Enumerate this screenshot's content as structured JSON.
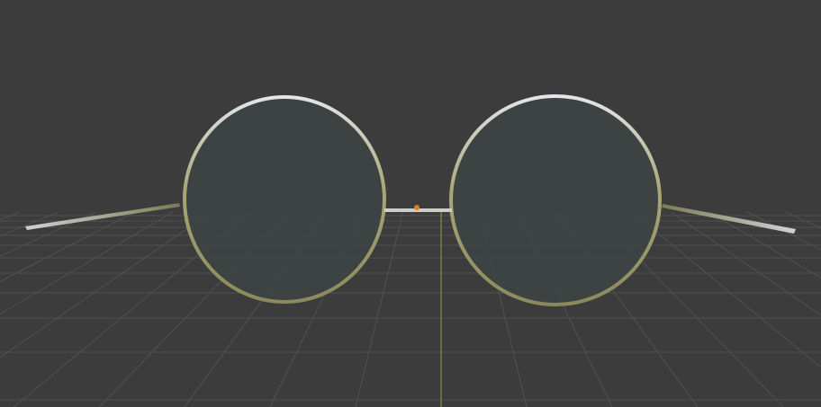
{
  "viewport": {
    "background_color": "#3c3c3c",
    "grid_color": "#565656",
    "axis_y_color": "#6e9a3a",
    "grid_visible": true
  },
  "model": {
    "name": "",
    "frame_color": "#9a9a6a",
    "frame_highlight_color": "#e2e6ea",
    "lens_color": "#3e4444",
    "origin_marker_color": "#e07a1e"
  }
}
